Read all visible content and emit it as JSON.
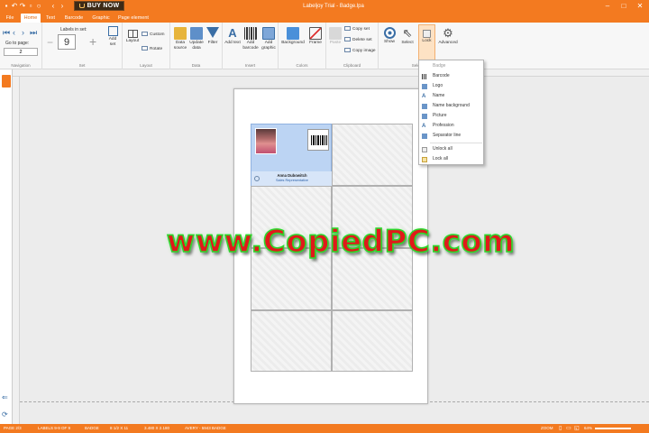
{
  "window": {
    "title": "Labeljoy Trial - Badge.lpa",
    "buy_now": "BUY NOW",
    "quick_access": [
      "save-icon",
      "undo-icon",
      "redo-icon",
      "print-icon",
      "search-icon",
      "back-icon",
      "forward-icon"
    ],
    "controls": [
      "minimize-icon",
      "maximize-icon",
      "close-icon"
    ]
  },
  "tabs": [
    "File",
    "Home",
    "Text",
    "Barcode",
    "Graphic",
    "Page element"
  ],
  "active_tab": "Home",
  "ribbon": {
    "navigation": {
      "go_to_page_label": "Go to page:",
      "page_value": "2",
      "group": "Navigation"
    },
    "set": {
      "labels_in_set_label": "Labels in set:",
      "labels_value": "9",
      "add_set": "Add set",
      "group": "Set"
    },
    "layout": {
      "layout": "Layout",
      "custom": "Custom",
      "rotate": "Rotate",
      "group": "Layout"
    },
    "data": {
      "data_source": "Data source",
      "update_data": "Update data",
      "filter": "Filter",
      "group": "Data"
    },
    "insert": {
      "add_text": "Add text",
      "add_barcode": "Add barcode",
      "add_graphic": "Add graphic",
      "group": "Insert"
    },
    "colors": {
      "background": "Background",
      "frame": "Frame",
      "group": "Colors"
    },
    "clipboard": {
      "paste": "Paste",
      "copy_set": "Copy set",
      "delete_set": "Delete set",
      "copy_image": "Copy image",
      "group": "Clipboard"
    },
    "selection": {
      "show": "Show",
      "select": "Select",
      "lock": "Lock",
      "advanced": "Advanced",
      "group": "Selection"
    }
  },
  "lock_menu": {
    "header": "Badge",
    "items": [
      "Barcode",
      "Logo",
      "Name",
      "Name background",
      "Picture",
      "Profession",
      "Separator line"
    ],
    "actions": [
      "Unlock all",
      "Lock all"
    ]
  },
  "badge": {
    "name": "Anna Dubowitch",
    "role": "Sales Representative"
  },
  "watermark": "www.CopiedPC.com",
  "status": {
    "page": "PAGE 2/3",
    "labels": "LABELS 9-9 OF 9",
    "type": "BADGE",
    "size": "8 1/2 X 11",
    "dims": "3.480 X 2.180",
    "template": "AVERY - 5943 BADGE",
    "zoom_label": "ZOOM",
    "zoom_value": "64%"
  },
  "colors": {
    "accent": "#f37a20",
    "badge_blue": "#bcd4f3"
  }
}
